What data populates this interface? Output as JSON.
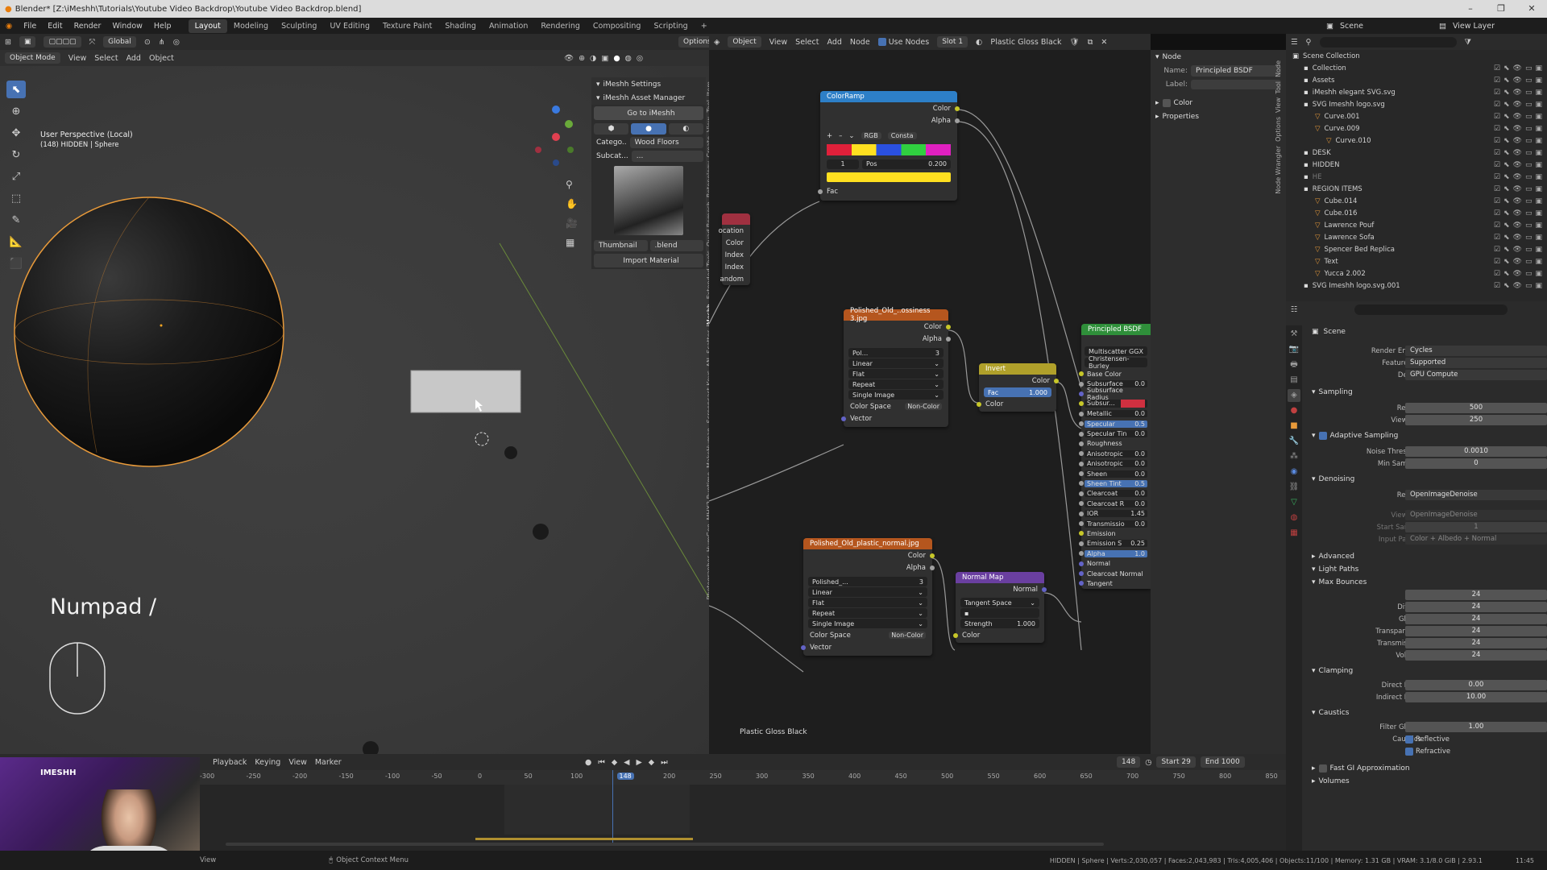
{
  "window": {
    "title": "Blender* [Z:\\iMeshh\\Tutorials\\Youtube Video Backdrop\\Youtube Video Backdrop.blend]"
  },
  "menu": [
    "File",
    "Edit",
    "Render",
    "Window",
    "Help"
  ],
  "workspaces": [
    "Layout",
    "Modeling",
    "Sculpting",
    "UV Editing",
    "Texture Paint",
    "Shading",
    "Animation",
    "Rendering",
    "Compositing",
    "Scripting"
  ],
  "viewport": {
    "header": {
      "transform": "Global",
      "options": "Options"
    },
    "subheader": {
      "mode": "Object Mode",
      "view": "View",
      "select": "Select",
      "add": "Add",
      "object": "Object"
    },
    "overlay_title": "User Perspective (Local)",
    "overlay_sub": "(148) HIDDEN | Sphere",
    "keypress": "Numpad /"
  },
  "npanel": {
    "settings": "iMeshh Settings",
    "manager": "iMeshh Asset Manager",
    "go_to": "Go to iMeshh",
    "category_label": "Catego..",
    "category_value": "Wood Floors",
    "subcat_label": "Subcat...",
    "subcat_value": "...",
    "thumbnail": "Thumbnail",
    "blend": ".blend",
    "import": "Import Material"
  },
  "sidetabs": [
    "Item",
    "Tool",
    "View",
    "Create",
    "Retopology",
    "Quad Remesh",
    "Extended Tools",
    "iMeshh",
    "Scatter",
    "AN",
    "Screencast Keys",
    "MakeHuman",
    "MHX2 Runtime",
    "HumGen",
    "Photographer"
  ],
  "node_header": {
    "object": "Object",
    "view": "View",
    "select": "Select",
    "add": "Add",
    "node": "Node",
    "use_nodes": "Use Nodes",
    "slot": "Slot 1",
    "material": "Plastic Gloss Black"
  },
  "node_editor": {
    "material_label": "Plastic Gloss Black",
    "colorramp": {
      "title": "ColorRamp",
      "color": "Color",
      "alpha": "Alpha",
      "mode": "RGB",
      "interp": "Consta",
      "index": "1",
      "pos_label": "Pos",
      "pos": "0.200",
      "fac": "Fac"
    },
    "partial": {
      "rows": [
        "ocation",
        "Color",
        "Index",
        "Index",
        "andom"
      ]
    },
    "tex1": {
      "title": "Polished_Old_..ossiness 3.jpg",
      "color": "Color",
      "alpha": "Alpha",
      "img": "Pol...",
      "users": "3",
      "interp": "Linear",
      "proj": "Flat",
      "ext": "Repeat",
      "src": "Single Image",
      "cs_label": "Color Space",
      "cs": "Non-Color",
      "vector": "Vector"
    },
    "invert": {
      "title": "Invert",
      "color": "Color",
      "fac_label": "Fac",
      "fac": "1.000",
      "color_in": "Color"
    },
    "tex2": {
      "title": "Polished_Old_plastic_normal.jpg",
      "color": "Color",
      "alpha": "Alpha",
      "img": "Polished_...",
      "users": "3",
      "interp": "Linear",
      "proj": "Flat",
      "ext": "Repeat",
      "src": "Single Image",
      "cs_label": "Color Space",
      "cs": "Non-Color",
      "vector": "Vector"
    },
    "normalmap": {
      "title": "Normal Map",
      "normal": "Normal",
      "space": "Tangent Space",
      "strength_label": "Strength",
      "strength": "1.000",
      "color": "Color"
    },
    "bsdf": {
      "title": "Principled BSDF",
      "dist": "Multiscatter GGX",
      "sss": "Christensen-Burley",
      "rows": [
        {
          "l": "Base Color",
          "v": ""
        },
        {
          "l": "Subsurface",
          "v": "0.0"
        },
        {
          "l": "Subsurface Radius",
          "v": ""
        },
        {
          "l": "Subsur...",
          "v": ""
        },
        {
          "l": "Metallic",
          "v": "0.0"
        },
        {
          "l": "Specular",
          "v": "0.5"
        },
        {
          "l": "Specular Tin",
          "v": "0.0"
        },
        {
          "l": "Roughness",
          "v": ""
        },
        {
          "l": "Anisotropic",
          "v": "0.0"
        },
        {
          "l": "Anisotropic",
          "v": "0.0"
        },
        {
          "l": "Sheen",
          "v": "0.0"
        },
        {
          "l": "Sheen Tint",
          "v": "0.5"
        },
        {
          "l": "Clearcoat",
          "v": "0.0"
        },
        {
          "l": "Clearcoat R",
          "v": "0.0"
        },
        {
          "l": "IOR",
          "v": "1.45"
        },
        {
          "l": "Transmissio",
          "v": "0.0"
        },
        {
          "l": "Emission",
          "v": ""
        },
        {
          "l": "Emission S",
          "v": "0.25"
        },
        {
          "l": "Alpha",
          "v": "1.0"
        },
        {
          "l": "Normal",
          "v": ""
        },
        {
          "l": "Clearcoat Normal",
          "v": ""
        },
        {
          "l": "Tangent",
          "v": ""
        }
      ]
    }
  },
  "node_props": {
    "tab": "Node",
    "name_label": "Name:",
    "name": "Principled BSDF",
    "label_label": "Label:",
    "color": "Color",
    "properties": "Properties"
  },
  "outliner": {
    "scene": "Scene",
    "view_layer": "View Layer",
    "rows": [
      {
        "t": "Scene Collection",
        "i": 0
      },
      {
        "t": "Collection",
        "i": 1
      },
      {
        "t": "Assets",
        "i": 1
      },
      {
        "t": "iMeshh elegant SVG.svg",
        "i": 1
      },
      {
        "t": "SVG Imeshh logo.svg",
        "i": 1
      },
      {
        "t": "Curve.001",
        "i": 2
      },
      {
        "t": "Curve.009",
        "i": 2
      },
      {
        "t": "Curve.010",
        "i": 3
      },
      {
        "t": "DESK",
        "i": 1
      },
      {
        "t": "HIDDEN",
        "i": 1
      },
      {
        "t": "HE",
        "i": 1
      },
      {
        "t": "REGION ITEMS",
        "i": 1
      },
      {
        "t": "Cube.014",
        "i": 2
      },
      {
        "t": "Cube.016",
        "i": 2
      },
      {
        "t": "Lawrence Pouf",
        "i": 2
      },
      {
        "t": "Lawrence Sofa",
        "i": 2
      },
      {
        "t": "Spencer Bed Replica",
        "i": 2
      },
      {
        "t": "Text",
        "i": 2
      },
      {
        "t": "Yucca 2.002",
        "i": 2
      },
      {
        "t": "SVG Imeshh logo.svg.001",
        "i": 1
      }
    ]
  },
  "properties": {
    "scene": "Scene",
    "render_engine_l": "Render Engine",
    "render_engine": "Cycles",
    "feature_set_l": "Feature Set",
    "feature_set": "Supported",
    "device_l": "Device",
    "device": "GPU Compute",
    "sampling": "Sampling",
    "render_l": "Render",
    "render": "500",
    "viewport_l": "Viewport",
    "viewport": "250",
    "adaptive": "Adaptive Sampling",
    "noise_l": "Noise Threshold",
    "noise": "0.0010",
    "min_l": "Min Samples",
    "min": "0",
    "denoising": "Denoising",
    "dn_render_l": "Render",
    "dn_render": "OpenImageDenoise",
    "dn_view_l": "Viewport",
    "dn_view": "OpenImageDenoise",
    "start_l": "Start Sample",
    "start": "1",
    "passes_l": "Input Passes",
    "passes": "Color + Albedo + Normal",
    "advanced": "Advanced",
    "light_paths": "Light Paths",
    "max_bounces": "Max Bounces",
    "bounces": [
      {
        "l": "Total",
        "v": "24"
      },
      {
        "l": "Diffuse",
        "v": "24"
      },
      {
        "l": "Glossy",
        "v": "24"
      },
      {
        "l": "Transparency",
        "v": "24"
      },
      {
        "l": "Transmission",
        "v": "24"
      },
      {
        "l": "Volume",
        "v": "24"
      }
    ],
    "clamping": "Clamping",
    "direct_l": "Direct Light",
    "direct": "0.00",
    "indirect_l": "Indirect Light",
    "indirect": "10.00",
    "caustics": "Caustics",
    "filter_l": "Filter Glossy",
    "filter": "1.00",
    "caustics_l": "Caustics",
    "reflective": "Reflective",
    "refractive": "Refractive",
    "fast_gi": "Fast GI Approximation",
    "volumes": "Volumes"
  },
  "timeline": {
    "menu": [
      "Playback",
      "Keying",
      "View",
      "Marker"
    ],
    "frame": "148",
    "start_l": "Start",
    "start": "29",
    "end_l": "End",
    "end": "1000",
    "ticks": [
      "-300",
      "-250",
      "-200",
      "-150",
      "-100",
      "-50",
      "0",
      "50",
      "100",
      "148",
      "200",
      "250",
      "300",
      "350",
      "400",
      "450",
      "500",
      "550",
      "600",
      "650",
      "700",
      "750",
      "800",
      "850"
    ]
  },
  "status": {
    "left": "View",
    "center": "Object Context Menu",
    "right": "HIDDEN | Sphere | Verts:2,030,057 | Faces:2,043,983 | Tris:4,005,406 | Objects:11/100 | Memory: 1.31 GB | VRAM: 3.1/8.0 GiB | 2.93.1",
    "clock": "11:45"
  },
  "webcam": {
    "logo": "IMESHH"
  },
  "colors": {
    "accent": "#4772b3",
    "select": "#f5a623",
    "bsdf_header": "#2f8f3a",
    "tex_header": "#b5561e",
    "vector_header": "#6a3fa0",
    "color_header": "#b0a02a",
    "input_header": "#2d7fc7"
  }
}
